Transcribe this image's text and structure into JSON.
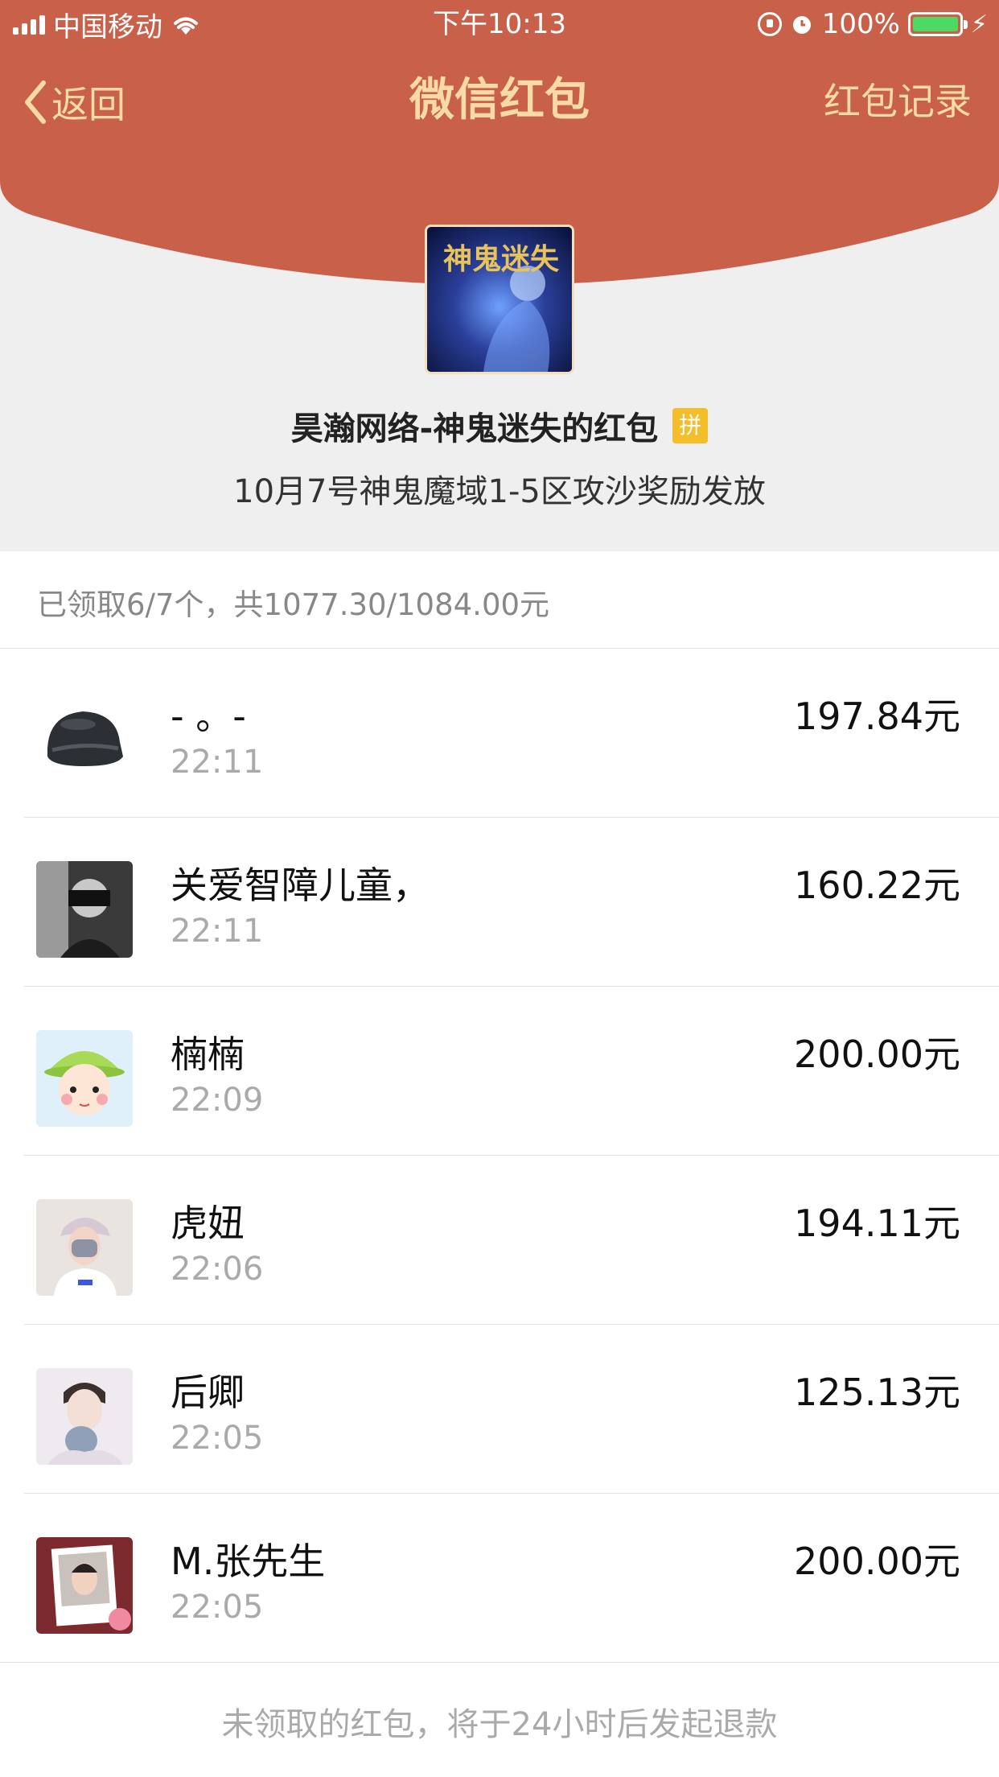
{
  "status_bar": {
    "carrier": "中国移动",
    "time": "下午10:13",
    "battery": "100%"
  },
  "nav": {
    "back_label": "返回",
    "title": "微信红包",
    "right_label": "红包记录"
  },
  "packet": {
    "logo_text": "神鬼迷失",
    "sender": "昊瀚网络-神鬼迷失的红包",
    "badge": "拼",
    "wish": "10月7号神鬼魔域1-5区攻沙奖励发放"
  },
  "summary": "已领取6/7个，共1077.30/1084.00元",
  "records": [
    {
      "name": "- 。-",
      "time": "22:11",
      "amount": "197.84元"
    },
    {
      "name": "关爱智障儿童，",
      "time": "22:11",
      "amount": "160.22元"
    },
    {
      "name": "楠楠",
      "time": "22:09",
      "amount": "200.00元"
    },
    {
      "name": "虎妞",
      "time": "22:06",
      "amount": "194.11元"
    },
    {
      "name": "后卿",
      "time": "22:05",
      "amount": "125.13元"
    },
    {
      "name": "M.张先生",
      "time": "22:05",
      "amount": "200.00元"
    }
  ],
  "footer": "未领取的红包，将于24小时后发起退款",
  "colors": {
    "header_red": "#c9614a",
    "nav_text": "#f8d9a8",
    "badge_yellow": "#f4bd2a",
    "battery_green": "#4cd964"
  }
}
